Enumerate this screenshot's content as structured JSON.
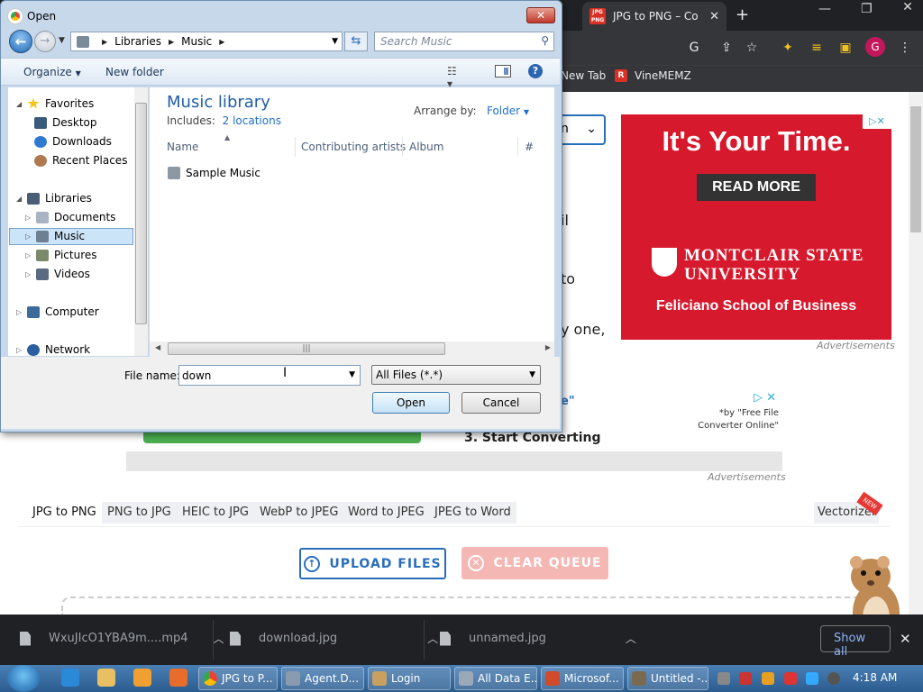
{
  "chrome": {
    "tab_title": "JPG to PNG – Co",
    "tab_favicon": "JPG PNG",
    "bookmarks": [
      "New Tab",
      "VineMEMZ"
    ],
    "profile_initial": "G"
  },
  "page": {
    "select_value": "n",
    "fragments": [
      "il",
      "to",
      "y one,",
      "e\""
    ],
    "ad": {
      "title": "It's Your Time.",
      "button": "READ MORE",
      "university": "MONTCLAIR STATE UNIVERSITY",
      "school": "Feliciano School of Business",
      "label": "Advertisements",
      "brand_color": "#d7192d"
    },
    "ad2": {
      "text": "*by \"Free File Converter Online\""
    },
    "ad_label2": "Advertisements",
    "start_converting": "3. Start Converting",
    "converter_tabs": [
      "JPG to PNG",
      "PNG to JPG",
      "HEIC to JPG",
      "WebP to JPEG",
      "Word to JPEG",
      "JPEG to Word"
    ],
    "vectorizer": "Vectorizer",
    "new_badge": "NEW",
    "upload_label": "UPLOAD FILES",
    "clear_label": "CLEAR QUEUE"
  },
  "downloads": {
    "items": [
      "WxuJIcO1YBA9m....mp4",
      "download.jpg",
      "unnamed.jpg"
    ],
    "show_all": "Show all"
  },
  "taskbar": {
    "windows": [
      "JPG to P...",
      "Agent.D...",
      "Login",
      "All Data E...",
      "Microsof...",
      "Untitled -..."
    ],
    "clock": "4:18 AM"
  },
  "dialog": {
    "title": "Open",
    "address": {
      "root": "Libraries",
      "current": "Music"
    },
    "search_placeholder": "Search Music",
    "toolbar": {
      "organize": "Organize",
      "new_folder": "New folder"
    },
    "nav": {
      "favorites": "Favorites",
      "desktop": "Desktop",
      "downloads": "Downloads",
      "recent": "Recent Places",
      "libraries": "Libraries",
      "documents": "Documents",
      "music": "Music",
      "pictures": "Pictures",
      "videos": "Videos",
      "computer": "Computer",
      "network": "Network"
    },
    "library_title": "Music library",
    "includes_label": "Includes:",
    "includes_link": "2 locations",
    "arrange_label": "Arrange by:",
    "arrange_value": "Folder",
    "columns": [
      "Name",
      "Contributing artists",
      "Album",
      "#"
    ],
    "files": [
      "Sample Music"
    ],
    "filename_label": "File name:",
    "filename_value": "down",
    "filter": "All Files (*.*)",
    "open_label": "Open",
    "cancel_label": "Cancel"
  }
}
